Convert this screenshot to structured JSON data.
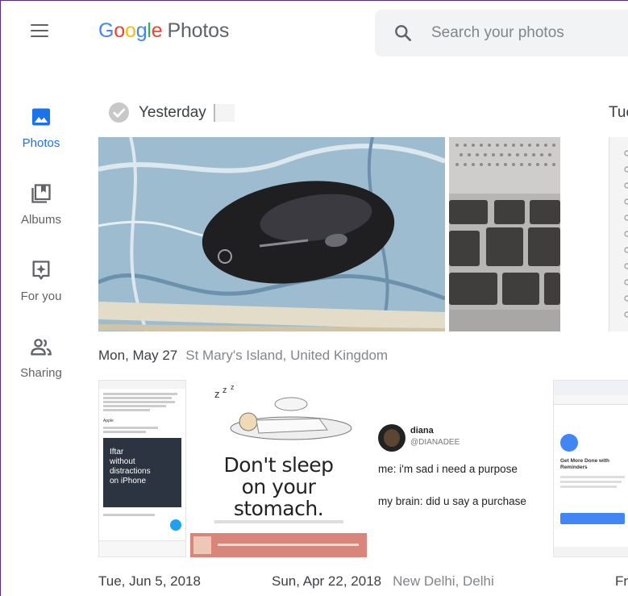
{
  "header": {
    "logo_google": [
      "G",
      "o",
      "o",
      "g",
      "l",
      "e"
    ],
    "logo_product": "Photos",
    "search_placeholder": "Search your photos"
  },
  "sidebar": {
    "items": [
      {
        "label": "Photos",
        "icon": "photo-icon",
        "active": true
      },
      {
        "label": "Albums",
        "icon": "albums-icon",
        "active": false
      },
      {
        "label": "For you",
        "icon": "for-you-icon",
        "active": false
      },
      {
        "label": "Sharing",
        "icon": "sharing-icon",
        "active": false
      }
    ]
  },
  "sections": {
    "yesterday": {
      "title": "Yesterday"
    },
    "tue_partial": {
      "title": "Tue"
    },
    "may27": {
      "date": "Mon, May 27",
      "location": "St Mary's Island, United Kingdom"
    },
    "jun5": {
      "date": "Tue, Jun 5, 2018"
    },
    "apr22": {
      "date": "Sun, Apr 22, 2018",
      "location": "New Delhi, Delhi"
    },
    "fri_partial": {
      "title": "Fr"
    }
  },
  "photos": {
    "tweet": {
      "author": "Apple",
      "ad_line1": "Iftar",
      "ad_line2": "without",
      "ad_line3": "distractions",
      "ad_line4": "on iPhone"
    },
    "poster": {
      "line1": "Don't sleep",
      "line2": "on your",
      "line3": "stomach."
    },
    "meme": {
      "name": "diana",
      "handle": "@DIANADEE",
      "line1": "me: i'm sad i need a purpose",
      "line2": "my brain: did u say a purchase"
    },
    "reminders": {
      "title": "Get More Done with Reminders"
    }
  },
  "colors": {
    "accent": "#1a73e8",
    "text_secondary": "#5f6368"
  }
}
